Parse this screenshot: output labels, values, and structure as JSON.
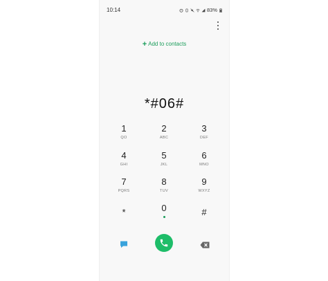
{
  "status_bar": {
    "time": "10:14",
    "battery_percent": "83%"
  },
  "header": {
    "add_to_contacts_label": "Add to contacts"
  },
  "dialer": {
    "entered_number": "*#06#",
    "keys": [
      {
        "digit": "1",
        "letters": "QO"
      },
      {
        "digit": "2",
        "letters": "ABC"
      },
      {
        "digit": "3",
        "letters": "DEF"
      },
      {
        "digit": "4",
        "letters": "GHI"
      },
      {
        "digit": "5",
        "letters": "JKL"
      },
      {
        "digit": "6",
        "letters": "MNO"
      },
      {
        "digit": "7",
        "letters": "PQRS"
      },
      {
        "digit": "8",
        "letters": "TUV"
      },
      {
        "digit": "9",
        "letters": "WXYZ"
      },
      {
        "digit": "*",
        "letters": ""
      },
      {
        "digit": "0",
        "letters": ""
      },
      {
        "digit": "#",
        "letters": ""
      }
    ]
  },
  "colors": {
    "accent_green": "#1a9c5a",
    "call_button": "#1ebd69",
    "message_icon": "#3aa3dc",
    "delete_icon": "#666666"
  },
  "icons": {
    "message": "message-icon",
    "call": "phone-icon",
    "delete": "backspace-icon",
    "more": "more-vertical-icon"
  }
}
